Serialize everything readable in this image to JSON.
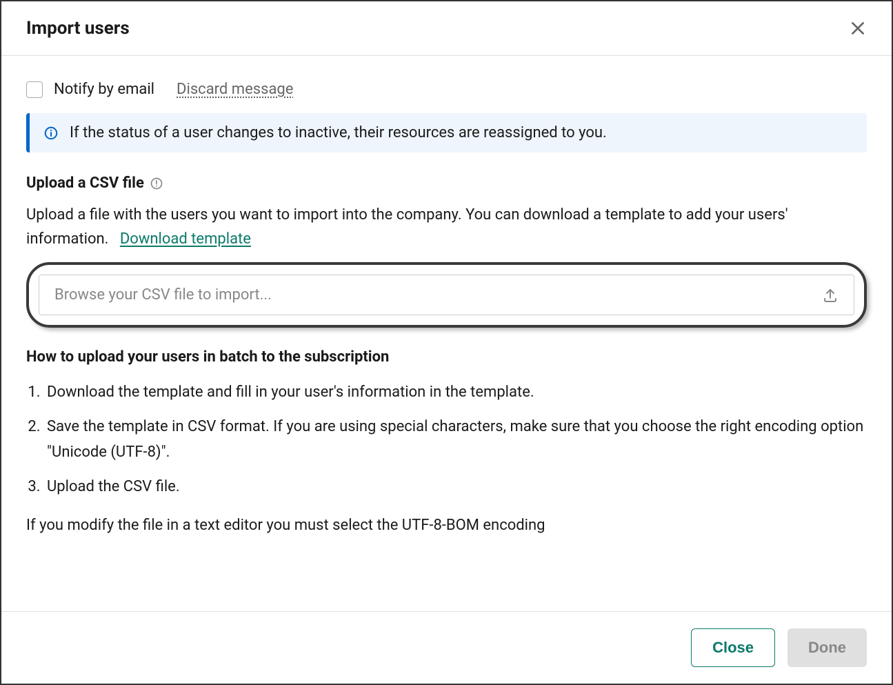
{
  "header": {
    "title": "Import users"
  },
  "notify": {
    "label": "Notify by email",
    "discard_label": "Discard message"
  },
  "info": {
    "text": "If the status of a user changes to inactive, their resources are reassigned to you."
  },
  "upload_section": {
    "title": "Upload a CSV file",
    "description_part1": "Upload a file with the users you want to import into the company. You can download a template to add your users' information.",
    "download_template_label": "Download template",
    "placeholder": "Browse your CSV file to import..."
  },
  "howto": {
    "title": "How to upload your users in batch to the subscription",
    "steps": [
      "Download the template and fill in your user's information in the template.",
      "Save the template in CSV format. If you are using special characters, make sure that you choose the right encoding option \"Unicode (UTF-8)\".",
      "Upload the CSV file."
    ],
    "note": "If you modify the file in a text editor you must select the UTF-8-BOM encoding"
  },
  "footer": {
    "close_label": "Close",
    "done_label": "Done"
  }
}
